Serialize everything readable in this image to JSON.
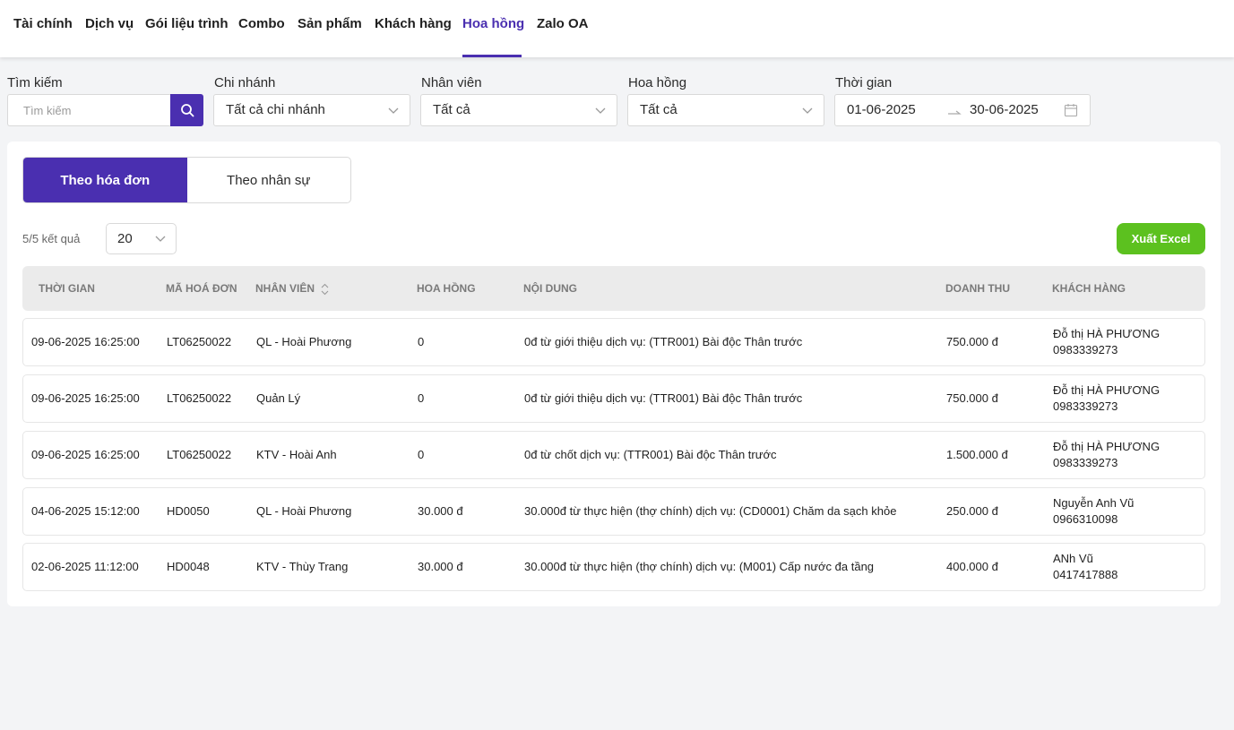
{
  "nav": {
    "tabs": [
      {
        "label": "Tài chính"
      },
      {
        "label": "Dịch vụ"
      },
      {
        "label": "Gói liệu trình"
      },
      {
        "label": "Combo"
      },
      {
        "label": "Sản phẩm"
      },
      {
        "label": "Khách hàng"
      },
      {
        "label": "Hoa hồng",
        "active": true
      },
      {
        "label": "Zalo OA"
      }
    ]
  },
  "filters": {
    "search": {
      "label": "Tìm kiếm",
      "placeholder": "Tìm kiếm",
      "value": ""
    },
    "branch": {
      "label": "Chi nhánh",
      "value": "Tất cả chi nhánh"
    },
    "staff": {
      "label": "Nhân viên",
      "value": "Tất cả"
    },
    "commission": {
      "label": "Hoa hồng",
      "value": "Tất cả"
    },
    "time": {
      "label": "Thời gian",
      "from": "01-06-2025",
      "to": "30-06-2025"
    }
  },
  "view_toggle": {
    "by_invoice": "Theo hóa đơn",
    "by_staff": "Theo nhân sự",
    "active": "by_invoice"
  },
  "results": {
    "count_text": "5/5 kết quả",
    "page_size": "20",
    "export_label": "Xuất Excel"
  },
  "colors": {
    "accent": "#4a2fb0",
    "export": "#5cc11f"
  },
  "table": {
    "headers": [
      "THỜI GIAN",
      "MÃ HOÁ ĐƠN",
      "NHÂN VIÊN",
      "HOA HỒNG",
      "NỘI DUNG",
      "DOANH THU",
      "KHÁCH HÀNG"
    ],
    "rows": [
      {
        "time": "09-06-2025 16:25:00",
        "invoice": "LT06250022",
        "staff": "QL - Hoài Phương",
        "commission": "0",
        "content": "0đ từ giới thiệu dịch vụ: (TTR001) Bài độc Thân trước",
        "revenue": "750.000 đ",
        "customer_name": "Đỗ thị HÀ PHƯƠNG",
        "customer_phone": "0983339273"
      },
      {
        "time": "09-06-2025 16:25:00",
        "invoice": "LT06250022",
        "staff": "Quản Lý",
        "commission": "0",
        "content": "0đ từ giới thiệu dịch vụ: (TTR001) Bài độc Thân trước",
        "revenue": "750.000 đ",
        "customer_name": "Đỗ thị HÀ PHƯƠNG",
        "customer_phone": "0983339273"
      },
      {
        "time": "09-06-2025 16:25:00",
        "invoice": "LT06250022",
        "staff": "KTV - Hoài Anh",
        "commission": "0",
        "content": "0đ từ chốt dịch vụ: (TTR001) Bài độc Thân trước",
        "revenue": "1.500.000 đ",
        "customer_name": "Đỗ thị HÀ PHƯƠNG",
        "customer_phone": "0983339273"
      },
      {
        "time": "04-06-2025 15:12:00",
        "invoice": "HD0050",
        "staff": "QL - Hoài Phương",
        "commission": "30.000 đ",
        "content": "30.000đ từ thực hiện (thợ chính) dịch vụ: (CD0001) Chăm da sạch khỏe",
        "revenue": "250.000 đ",
        "customer_name": "Nguyễn Anh Vũ",
        "customer_phone": "0966310098"
      },
      {
        "time": "02-06-2025 11:12:00",
        "invoice": "HD0048",
        "staff": "KTV - Thùy Trang",
        "commission": "30.000 đ",
        "content": "30.000đ từ thực hiện (thợ chính) dịch vụ: (M001) Cấp nước đa tầng",
        "revenue": "400.000 đ",
        "customer_name": "ANh Vũ",
        "customer_phone": "0417417888"
      }
    ]
  }
}
